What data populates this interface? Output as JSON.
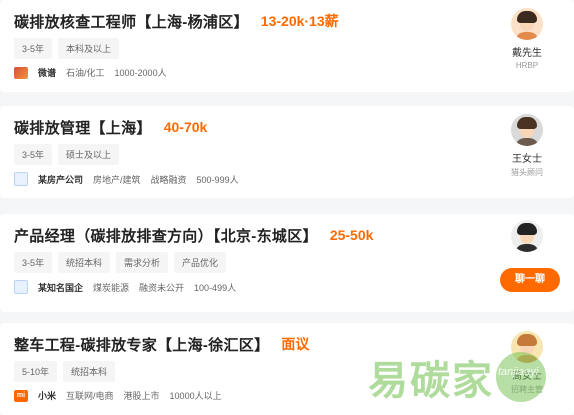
{
  "jobs": [
    {
      "title": "碳排放核查工程师【上海-杨浦区】",
      "salary": "13-20k·13薪",
      "tags": [
        "3-5年",
        "本科及以上"
      ],
      "company": "微谱",
      "meta": [
        "石油/化工",
        "1000-2000人"
      ],
      "recruiter_name": "戴先生",
      "recruiter_role": "HRBP"
    },
    {
      "title": "碳排放管理【上海】",
      "salary": "40-70k",
      "tags": [
        "3-5年",
        "硕士及以上"
      ],
      "company": "某房产公司",
      "meta": [
        "房地产/建筑",
        "战略融资",
        "500-999人"
      ],
      "recruiter_name": "王女士",
      "recruiter_role": "猎头顾问"
    },
    {
      "title": "产品经理（碳排放排查方向）【北京-东城区】",
      "salary": "25-50k",
      "tags": [
        "3-5年",
        "统招本科",
        "需求分析",
        "产品优化"
      ],
      "company": "某知名国企",
      "meta": [
        "煤炭能源",
        "融资未公开",
        "100-499人"
      ],
      "chat_label": "聊一聊"
    },
    {
      "title": "整车工程-碳排放专家【上海-徐汇区】",
      "salary": "面议",
      "tags": [
        "5-10年",
        "统招本科"
      ],
      "company": "小米",
      "meta": [
        "互联网/电商",
        "港股上市",
        "10000人以上"
      ],
      "recruiter_name": "高女士",
      "recruiter_role": "招聘主管",
      "logo_text": "mi"
    }
  ],
  "watermark": {
    "text": "易碳家",
    "url": "tanjiaayi"
  }
}
